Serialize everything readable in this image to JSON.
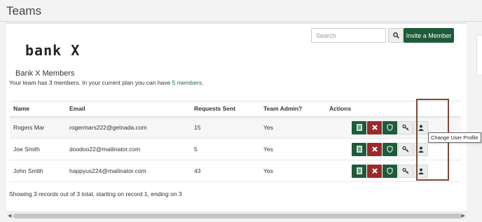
{
  "page": {
    "title": "Teams"
  },
  "toolbar": {
    "search_placeholder": "Search",
    "invite_label": "Invite a Member"
  },
  "team": {
    "logo_text": "bank X",
    "name": "Bank X Members",
    "info_prefix": "Your team has 3 members. In your current plan you can have ",
    "info_count": "5 members",
    "info_suffix": "."
  },
  "table": {
    "headers": [
      "Name",
      "Email",
      "Requests Sent",
      "Team Admin?",
      "Actions"
    ],
    "rows": [
      {
        "name": "Rogers Mar",
        "email": "rogermars222@getnada.com",
        "requests": "15",
        "admin": "Yes"
      },
      {
        "name": "Joe Smith",
        "email": "doodoo22@mailinator.com",
        "requests": "5",
        "admin": "Yes"
      },
      {
        "name": "John Smith",
        "email": "happyus224@mailinator.com",
        "requests": "43",
        "admin": "Yes"
      }
    ],
    "action_icons": [
      "report-icon",
      "remove-icon",
      "shield-icon",
      "key-icon",
      "user-icon"
    ]
  },
  "tooltip": "Change User Profile",
  "footer": {
    "records_text": "Showing 3 records out of 3 total, starting on record 1, ending on 3"
  },
  "colors": {
    "primary": "#1f5b3a",
    "danger": "#9c2a2a",
    "highlight": "#7a4a35"
  }
}
